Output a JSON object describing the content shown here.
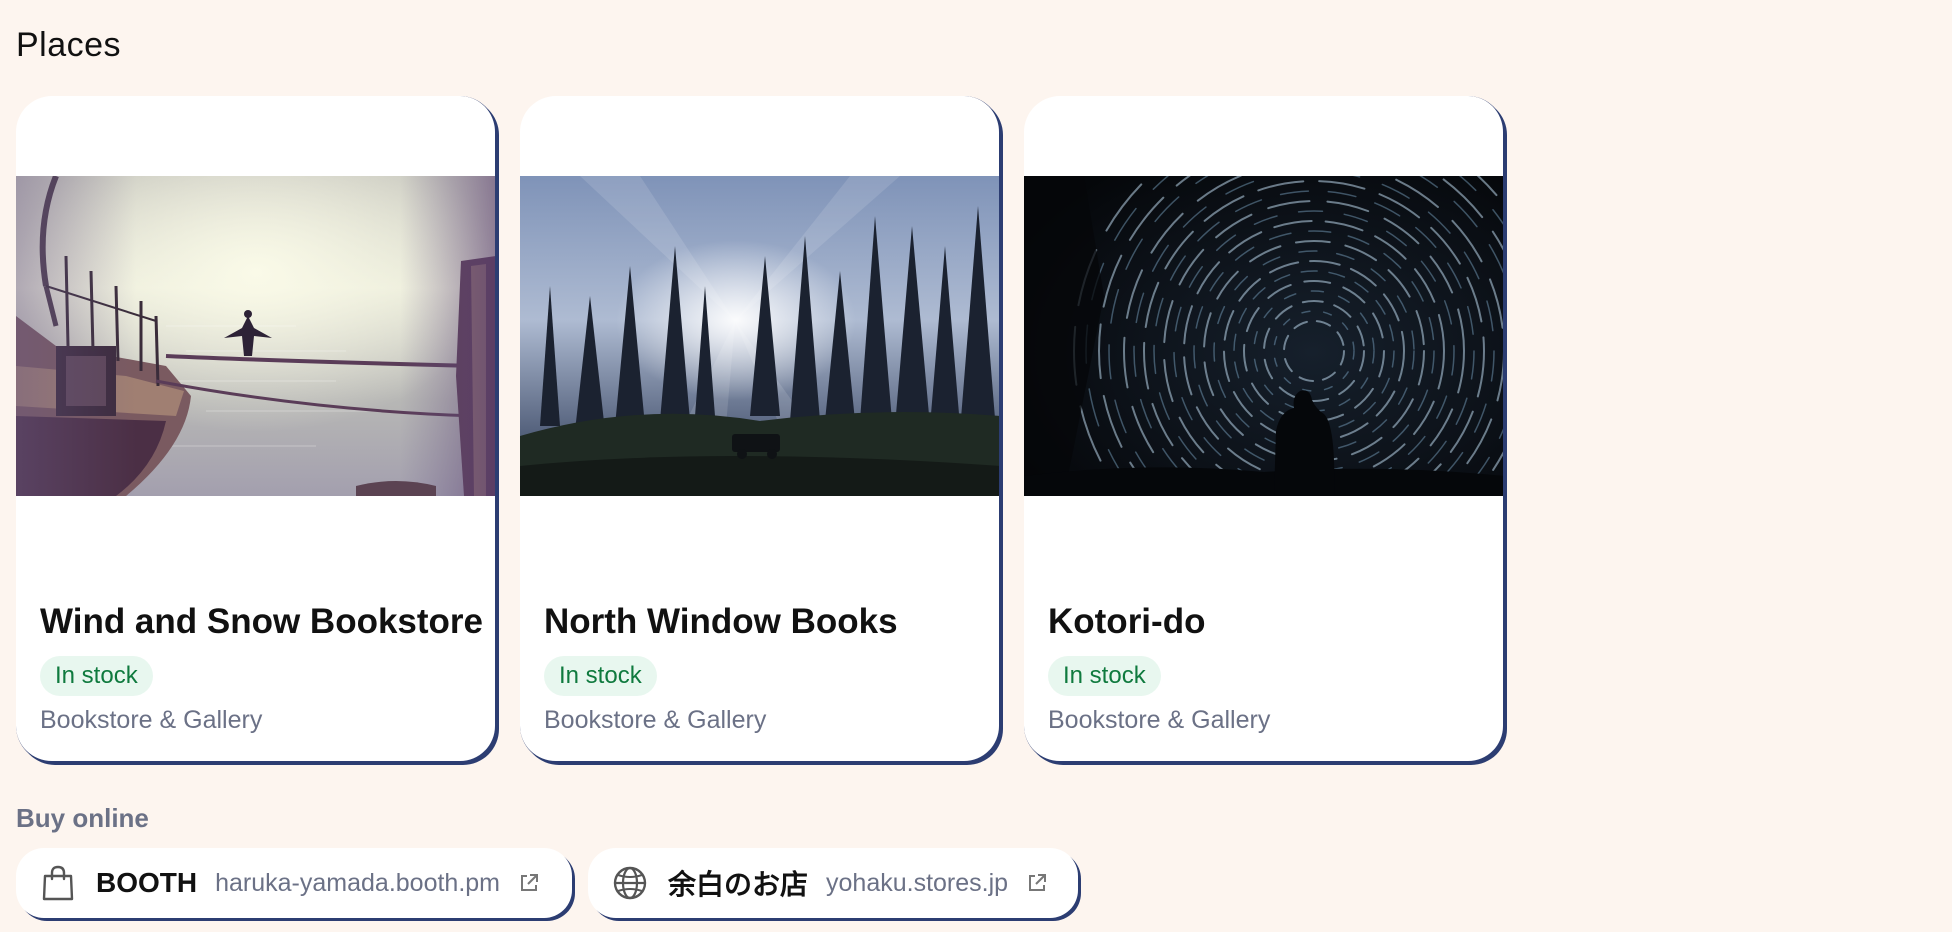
{
  "places": {
    "title": "Places",
    "cards": [
      {
        "name": "Wind and Snow Bookstore",
        "stock": "In stock",
        "category": "Bookstore & Gallery",
        "image": "harbor-cormorant-photo"
      },
      {
        "name": "North Window Books",
        "stock": "In stock",
        "category": "Bookstore & Gallery",
        "image": "forest-sunrays-photo"
      },
      {
        "name": "Kotori-do",
        "stock": "In stock",
        "category": "Bookstore & Gallery",
        "image": "star-trails-silhouette-photo"
      }
    ]
  },
  "buy_online": {
    "title": "Buy online",
    "links": [
      {
        "name": "BOOTH",
        "url": "haruka-yamada.booth.pm",
        "icon": "shopping-bag-icon"
      },
      {
        "name": "余白のお店",
        "url": "yohaku.stores.jp",
        "icon": "globe-icon"
      }
    ]
  },
  "colors": {
    "background": "#fdf5ef",
    "card_border": "#2c3d72",
    "badge_bg": "#e8f7ef",
    "badge_text": "#0f7a3e",
    "muted_text": "#6b7186"
  }
}
